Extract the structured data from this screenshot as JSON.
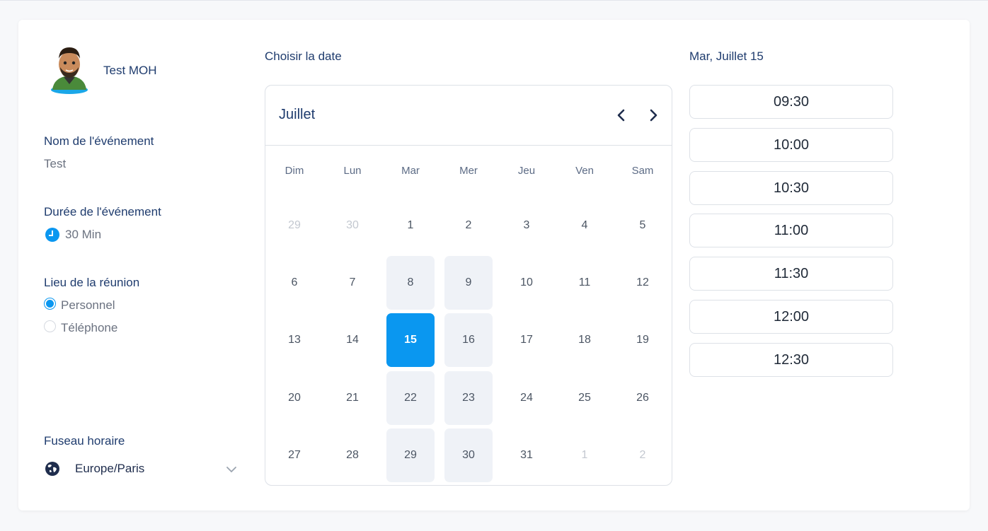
{
  "host": {
    "name": "Test MOH"
  },
  "event": {
    "name_label": "Nom de l'événement",
    "name_value": "Test",
    "duration_label": "Durée de l'événement",
    "duration_value": "30 Min",
    "location_label": "Lieu de la réunion",
    "locations": [
      {
        "label": "Personnel",
        "selected": true
      },
      {
        "label": "Téléphone",
        "selected": false
      }
    ]
  },
  "timezone": {
    "label": "Fuseau horaire",
    "value": "Europe/Paris"
  },
  "calendar": {
    "heading": "Choisir la date",
    "month": "Juillet",
    "weekdays": [
      "Dim",
      "Lun",
      "Mar",
      "Mer",
      "Jeu",
      "Ven",
      "Sam"
    ],
    "weeks": [
      [
        {
          "d": "29",
          "state": "muted"
        },
        {
          "d": "30",
          "state": "muted"
        },
        {
          "d": "1",
          "state": "normal"
        },
        {
          "d": "2",
          "state": "normal"
        },
        {
          "d": "3",
          "state": "normal"
        },
        {
          "d": "4",
          "state": "normal"
        },
        {
          "d": "5",
          "state": "normal"
        }
      ],
      [
        {
          "d": "6",
          "state": "normal"
        },
        {
          "d": "7",
          "state": "normal"
        },
        {
          "d": "8",
          "state": "avail"
        },
        {
          "d": "9",
          "state": "avail"
        },
        {
          "d": "10",
          "state": "normal"
        },
        {
          "d": "11",
          "state": "normal"
        },
        {
          "d": "12",
          "state": "normal"
        }
      ],
      [
        {
          "d": "13",
          "state": "normal"
        },
        {
          "d": "14",
          "state": "normal"
        },
        {
          "d": "15",
          "state": "selected"
        },
        {
          "d": "16",
          "state": "avail"
        },
        {
          "d": "17",
          "state": "normal"
        },
        {
          "d": "18",
          "state": "normal"
        },
        {
          "d": "19",
          "state": "normal"
        }
      ],
      [
        {
          "d": "20",
          "state": "normal"
        },
        {
          "d": "21",
          "state": "normal"
        },
        {
          "d": "22",
          "state": "avail"
        },
        {
          "d": "23",
          "state": "avail"
        },
        {
          "d": "24",
          "state": "normal"
        },
        {
          "d": "25",
          "state": "normal"
        },
        {
          "d": "26",
          "state": "normal"
        }
      ],
      [
        {
          "d": "27",
          "state": "normal"
        },
        {
          "d": "28",
          "state": "normal"
        },
        {
          "d": "29",
          "state": "avail"
        },
        {
          "d": "30",
          "state": "avail"
        },
        {
          "d": "31",
          "state": "normal"
        },
        {
          "d": "1",
          "state": "muted"
        },
        {
          "d": "2",
          "state": "muted"
        }
      ]
    ]
  },
  "times": {
    "heading": "Mar, Juillet 15",
    "slots": [
      "09:30",
      "10:00",
      "10:30",
      "11:00",
      "11:30",
      "12:00",
      "12:30"
    ]
  },
  "colors": {
    "accent": "#0a97f0",
    "available_bg": "#eff2f7",
    "heading": "#1f3c6e"
  },
  "icons": {
    "avatar": "bitmoji-avatar",
    "duration": "clock-icon",
    "timezone": "globe-icon",
    "tz_toggle": "chevron-down-icon",
    "prev": "chevron-left-icon",
    "next": "chevron-right-icon"
  }
}
